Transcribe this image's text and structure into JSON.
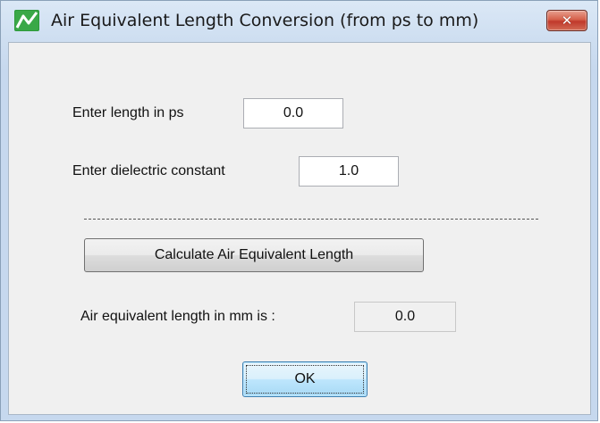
{
  "window": {
    "title": "Air Equivalent Length Conversion (from ps to mm)",
    "close_label": "✕"
  },
  "form": {
    "length_label": "Enter length in ps",
    "length_value": "0.0",
    "dielectric_label": "Enter dielectric constant",
    "dielectric_value": "1.0",
    "calculate_label": "Calculate Air Equivalent Length",
    "result_label": "Air equivalent length in mm is :",
    "result_value": "0.0",
    "ok_label": "OK"
  },
  "colors": {
    "accent": "#3c7fb1",
    "close": "#c0392b",
    "icon_green": "#2e9a3b"
  },
  "icons": {
    "app": "waveform-icon",
    "close": "close-icon"
  }
}
